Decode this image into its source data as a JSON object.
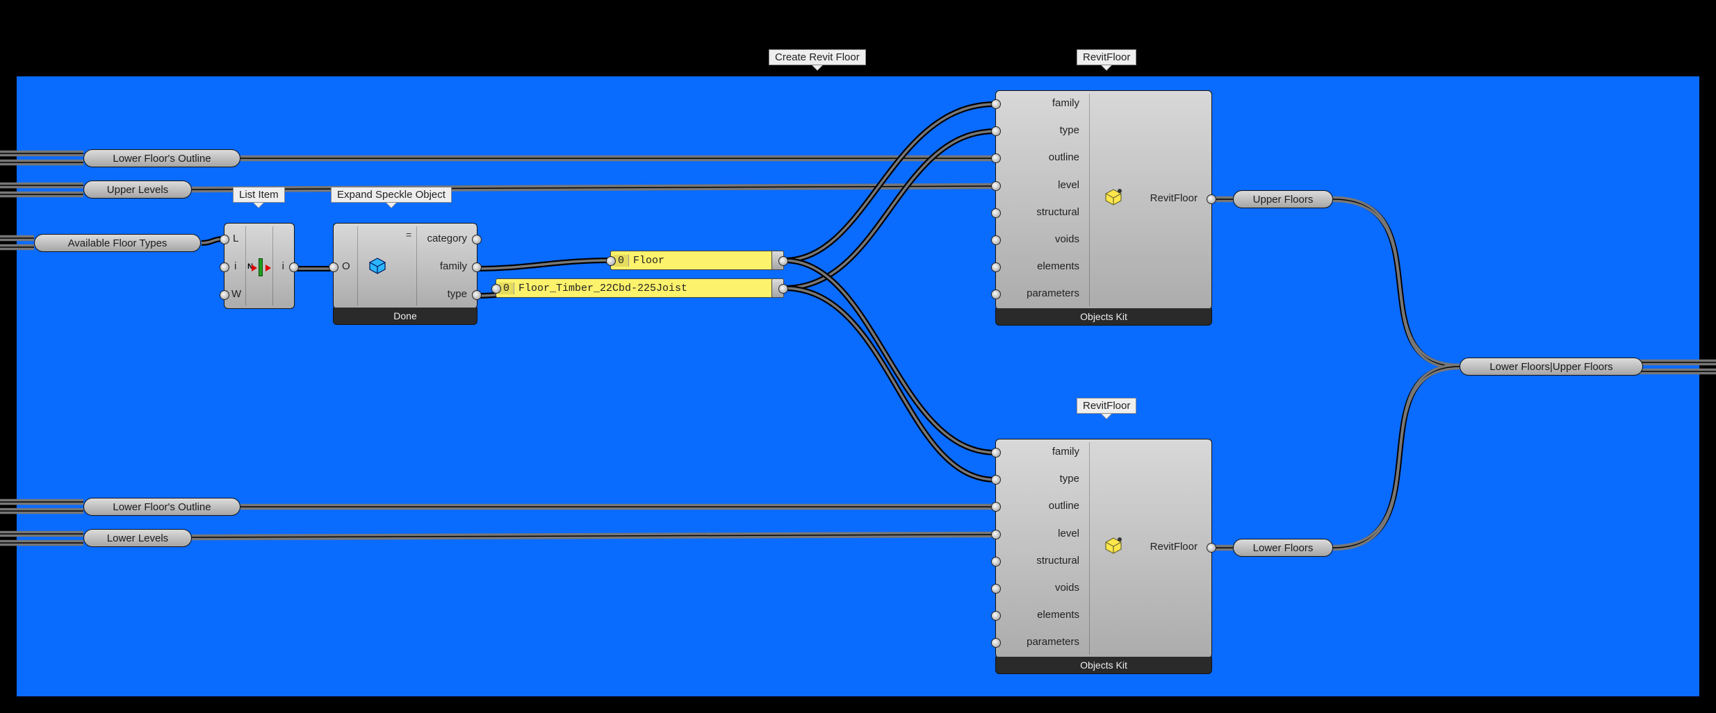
{
  "tooltips": {
    "create_revit_floor": "Create Revit Floor",
    "revitfloor1": "RevitFloor",
    "revitfloor2": "RevitFloor",
    "list_item": "List Item",
    "expand_speckle_object": "Expand Speckle Object"
  },
  "capsules": {
    "lower_floor_outline_1": "Lower Floor's Outline",
    "upper_levels": "Upper Levels",
    "available_floor_types": "Available Floor Types",
    "lower_floor_outline_2": "Lower Floor's Outline",
    "lower_levels": "Lower Levels",
    "upper_floors": "Upper Floors",
    "lower_floors": "Lower Floors",
    "merged_floors": "Lower Floors|Upper Floors"
  },
  "list_item_comp": {
    "inputs": [
      "L",
      "i",
      "W"
    ],
    "outputs": [
      "i"
    ]
  },
  "expand_comp": {
    "input": "O",
    "outputs": [
      "category",
      "family",
      "type"
    ],
    "footer": "Done"
  },
  "panels": {
    "family": {
      "idx": "0",
      "text": "Floor"
    },
    "type": {
      "idx": "0",
      "text": "Floor_Timber_22Cbd-225Joist"
    }
  },
  "revit_floor_comp": {
    "inputs": [
      "family",
      "type",
      "outline",
      "level",
      "structural",
      "voids",
      "elements",
      "parameters"
    ],
    "output": "RevitFloor",
    "footer": "Objects Kit"
  }
}
